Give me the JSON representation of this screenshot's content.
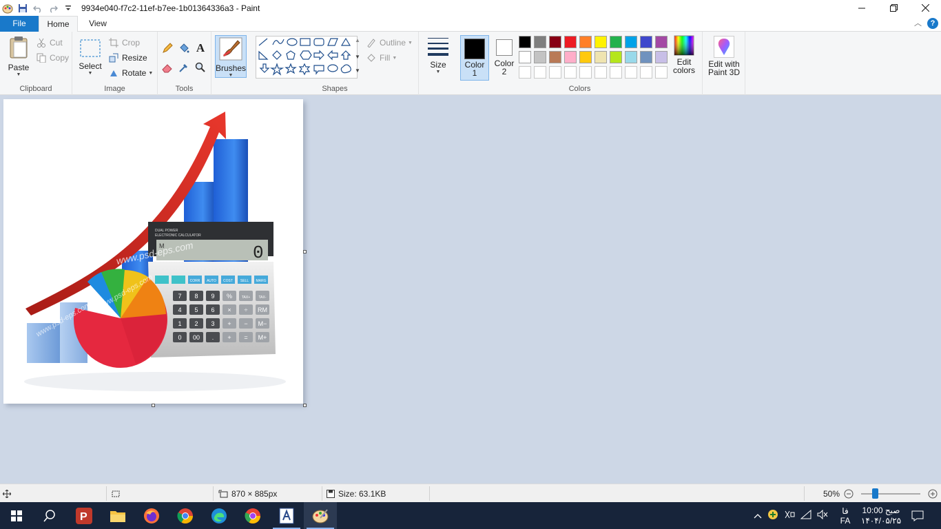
{
  "window": {
    "title": "9934e040-f7c2-11ef-b7ee-1b01364336a3 - Paint",
    "controls": [
      "minimize",
      "restore",
      "close"
    ]
  },
  "tabs": {
    "file": "File",
    "home": "Home",
    "view": "View"
  },
  "ribbon": {
    "clipboard": {
      "label": "Clipboard",
      "paste": "Paste",
      "cut": "Cut",
      "copy": "Copy"
    },
    "image": {
      "label": "Image",
      "select": "Select",
      "crop": "Crop",
      "resize": "Resize",
      "rotate": "Rotate"
    },
    "tools": {
      "label": "Tools"
    },
    "brushes": {
      "label": "Brushes"
    },
    "shapes": {
      "label": "Shapes",
      "outline": "Outline",
      "fill": "Fill"
    },
    "size": {
      "label": "Size"
    },
    "colors": {
      "label": "Colors",
      "color1_a": "Color",
      "color1_b": "1",
      "color2_a": "Color",
      "color2_b": "2",
      "edit_a": "Edit",
      "edit_b": "colors",
      "color1_value": "#000000",
      "color2_value": "#ffffff",
      "palette_row1": [
        "#000000",
        "#7f7f7f",
        "#880015",
        "#ed1c24",
        "#ff7f27",
        "#fff200",
        "#22b14c",
        "#00a2e8",
        "#3f48cc",
        "#a349a4"
      ],
      "palette_row2": [
        "#ffffff",
        "#c3c3c3",
        "#b97a57",
        "#ffaec9",
        "#ffc90e",
        "#efe4b0",
        "#b5e61d",
        "#99d9ea",
        "#7092be",
        "#c8bfe7"
      ]
    },
    "paint3d": {
      "line1": "Edit with",
      "line2": "Paint 3D"
    }
  },
  "canvas_image": {
    "watermark": "www.psd-eps.com",
    "calculator_brand_1": "DUAL POWER",
    "calculator_brand_2": "ELECTRONIC CALCULATOR",
    "display_memory": "M",
    "display_value": "0",
    "function_keys": [
      "",
      "",
      "CORR",
      "AUTO",
      "COST",
      "SELL",
      "MARG"
    ],
    "keypad_rows": [
      [
        "7",
        "8",
        "9",
        "%",
        "TAX+",
        "TAX-"
      ],
      [
        "4",
        "5",
        "6",
        "×",
        "÷",
        "RM"
      ],
      [
        "1",
        "2",
        "3",
        "+",
        "−",
        "M−"
      ],
      [
        "0",
        "00",
        ".",
        "+",
        "=",
        "M+"
      ]
    ]
  },
  "status": {
    "dimensions": "870 × 885px",
    "size": "Size: 63.1KB",
    "zoom": "50%",
    "zoom_level": 0.5
  },
  "taskbar": {
    "lang_top": "فا",
    "lang_bottom": "FA",
    "time": "صبح 10:00",
    "date": "۱۴۰۴/۰۵/۲۵"
  }
}
